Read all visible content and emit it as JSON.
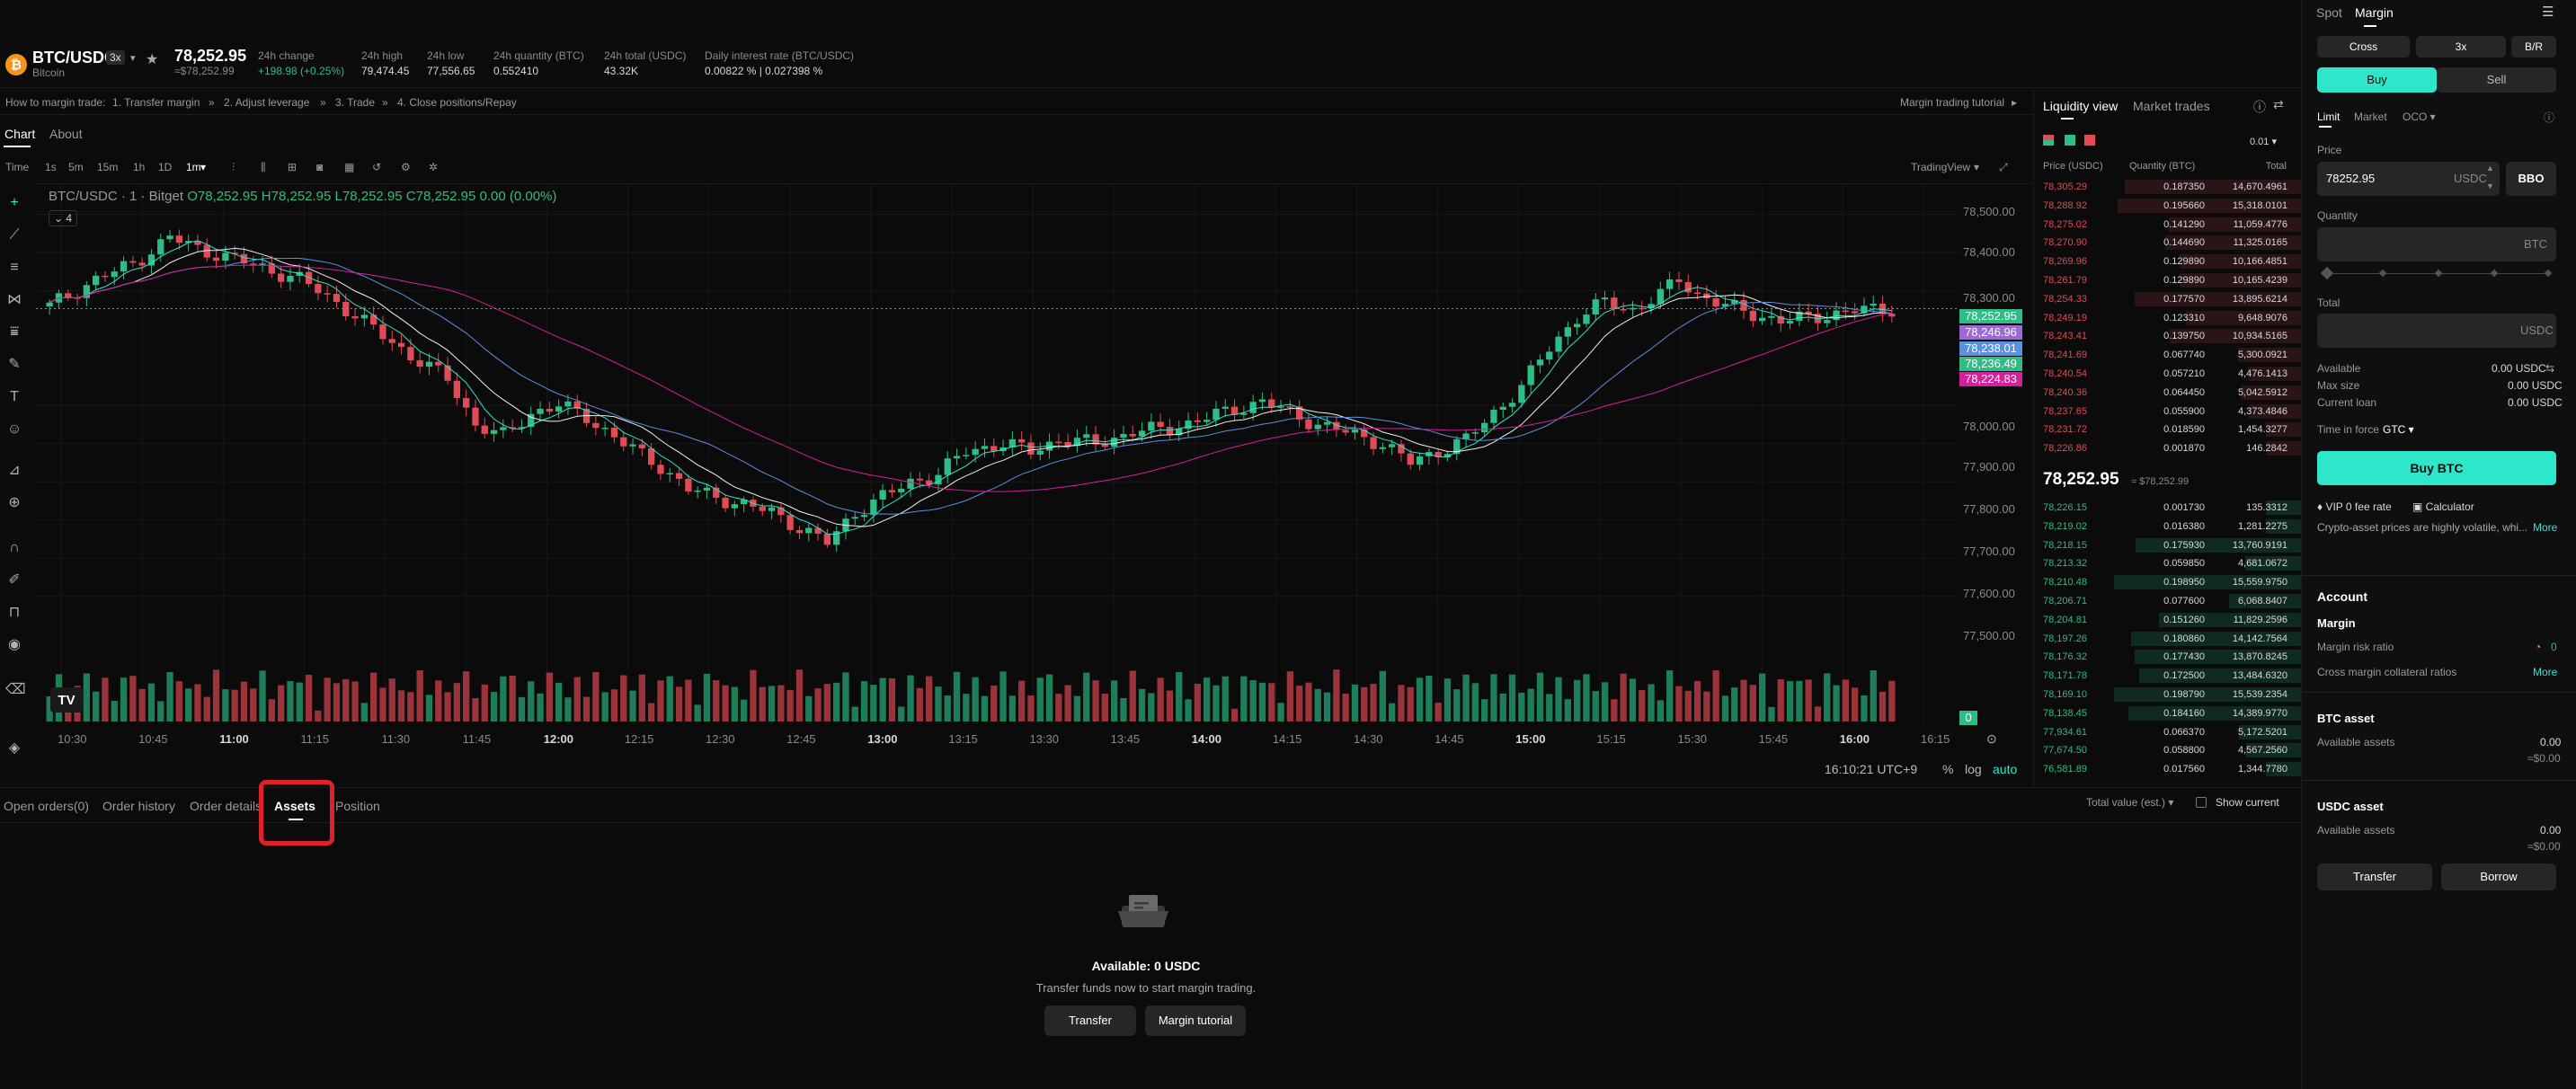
{
  "ticker": {
    "pair": "BTC/USDC",
    "leverage": "3x",
    "coin_name": "Bitcoin",
    "coin_glyph": "₿",
    "last_price": "78,252.95",
    "last_price_usd": "≈$78,252.99",
    "stats": [
      {
        "label": "24h change",
        "value": "+198.98 (+0.25%)"
      },
      {
        "label": "24h high",
        "value": "79,474.45"
      },
      {
        "label": "24h low",
        "value": "77,556.65"
      },
      {
        "label": "24h quantity (BTC)",
        "value": "0.552410"
      },
      {
        "label": "24h total (USDC)",
        "value": "43.32K"
      },
      {
        "label": "Daily interest rate (BTC/USDC)",
        "value": "0.00822 % | 0.027398 %"
      }
    ]
  },
  "tutorial": {
    "lead": "How to margin trade:",
    "steps": [
      "1. Transfer margin",
      "2. Adjust leverage",
      "3. Trade",
      "4. Close positions/Repay"
    ],
    "sep": "»",
    "link": "Margin trading tutorial"
  },
  "chart_tabs": [
    "Chart",
    "About"
  ],
  "chart_toolbar": {
    "intervals": [
      "Time",
      "1s",
      "5m",
      "15m",
      "1h",
      "1D",
      "1m"
    ],
    "provider": "TradingView"
  },
  "chart_legend": {
    "title": "BTC/USDC · 1 · Bitget",
    "o": "O78,252.95",
    "h": "H78,252.95",
    "l": "L78,252.95",
    "c": "C78,252.95",
    "chg": "0.00 (0.00%)",
    "indicator_count": "4",
    "logo": "TV"
  },
  "chart_data": {
    "type": "candlestick",
    "interval": "1m",
    "y_ticks": [
      "78,500.00",
      "78,400.00",
      "78,300.00",
      "78,000.00",
      "77,900.00",
      "77,800.00",
      "77,700.00",
      "77,600.00",
      "77,500.00"
    ],
    "ylim": [
      77450,
      78560
    ],
    "x_ticks": [
      "10:30",
      "10:45",
      "11:00",
      "11:15",
      "11:30",
      "11:45",
      "12:00",
      "12:15",
      "12:30",
      "12:45",
      "13:00",
      "13:15",
      "13:30",
      "13:45",
      "14:00",
      "14:15",
      "14:30",
      "14:45",
      "15:00",
      "15:15",
      "15:30",
      "15:45",
      "16:00",
      "16:15"
    ],
    "bold_x_ticks": [
      "11:00",
      "12:00",
      "13:00",
      "14:00",
      "15:00",
      "16:00"
    ],
    "close_path": [
      [
        0,
        78260
      ],
      [
        5,
        78330
      ],
      [
        9,
        78370
      ],
      [
        13,
        78440
      ],
      [
        16,
        78410
      ],
      [
        19,
        78390
      ],
      [
        23,
        78360
      ],
      [
        27,
        78330
      ],
      [
        31,
        78270
      ],
      [
        35,
        78200
      ],
      [
        39,
        78130
      ],
      [
        43,
        78070
      ],
      [
        46,
        77950
      ],
      [
        49,
        77920
      ],
      [
        52,
        77980
      ],
      [
        55,
        78000
      ],
      [
        58,
        77970
      ],
      [
        62,
        77900
      ],
      [
        66,
        77840
      ],
      [
        69,
        77780
      ],
      [
        72,
        77760
      ],
      [
        75,
        77740
      ],
      [
        78,
        77720
      ],
      [
        81,
        77680
      ],
      [
        84,
        77640
      ],
      [
        87,
        77720
      ],
      [
        90,
        77760
      ],
      [
        93,
        77800
      ],
      [
        96,
        77820
      ],
      [
        99,
        77880
      ],
      [
        103,
        77900
      ],
      [
        106,
        77880
      ],
      [
        109,
        77910
      ],
      [
        113,
        77900
      ],
      [
        117,
        77930
      ],
      [
        121,
        77940
      ],
      [
        124,
        77960
      ],
      [
        128,
        77990
      ],
      [
        131,
        78010
      ],
      [
        134,
        77980
      ],
      [
        137,
        77950
      ],
      [
        140,
        77930
      ],
      [
        144,
        77900
      ],
      [
        147,
        77850
      ],
      [
        150,
        77880
      ],
      [
        153,
        77910
      ],
      [
        156,
        77980
      ],
      [
        159,
        78050
      ],
      [
        162,
        78150
      ],
      [
        165,
        78230
      ],
      [
        168,
        78270
      ],
      [
        171,
        78250
      ],
      [
        174,
        78290
      ],
      [
        176,
        78330
      ],
      [
        178,
        78290
      ],
      [
        181,
        78260
      ],
      [
        184,
        78240
      ],
      [
        187,
        78220
      ],
      [
        190,
        78230
      ],
      [
        193,
        78240
      ],
      [
        196,
        78250
      ],
      [
        199,
        78253
      ]
    ],
    "price_tags": [
      {
        "value": "78,252.95",
        "color": "#2ebd85"
      },
      {
        "value": "78,246.96",
        "color": "#9b6ad4"
      },
      {
        "value": "78,238.01",
        "color": "#5b8fe0"
      },
      {
        "value": "78,236.49",
        "color": "#2ebd85"
      },
      {
        "value": "78,224.83",
        "color": "#d4209a"
      }
    ],
    "volume_tag": "0"
  },
  "timestamp": "16:10:21 UTC+9",
  "scale_opts": [
    "%",
    "log",
    "auto"
  ],
  "orderbook": {
    "tabs": [
      "Liquidity view",
      "Market trades"
    ],
    "tick": "0.01",
    "headers": [
      "Price (USDC)",
      "Quantity (BTC)",
      "Total"
    ],
    "asks": [
      [
        "78,305.29",
        "0.187350",
        "14,670.4961"
      ],
      [
        "78,288.92",
        "0.195660",
        "15,318.0101"
      ],
      [
        "78,275.02",
        "0.141290",
        "11,059.4776"
      ],
      [
        "78,270.90",
        "0.144690",
        "11,325.0165"
      ],
      [
        "78,269.96",
        "0.129890",
        "10,166.4851"
      ],
      [
        "78,261.79",
        "0.129890",
        "10,165.4239"
      ],
      [
        "78,254.33",
        "0.177570",
        "13,895.6214"
      ],
      [
        "78,249.19",
        "0.123310",
        "9,648.9076"
      ],
      [
        "78,243.41",
        "0.139750",
        "10,934.5165"
      ],
      [
        "78,241.69",
        "0.067740",
        "5,300.0921"
      ],
      [
        "78,240.54",
        "0.057210",
        "4,476.1413"
      ],
      [
        "78,240.36",
        "0.064450",
        "5,042.5912"
      ],
      [
        "78,237.65",
        "0.055900",
        "4,373.4846"
      ],
      [
        "78,231.72",
        "0.018590",
        "1,454.3277"
      ],
      [
        "78,226.86",
        "0.001870",
        "146.2842"
      ]
    ],
    "mid_price": "78,252.95",
    "mid_usd": "≈ $78,252.99",
    "bids": [
      [
        "78,226.15",
        "0.001730",
        "135.3312"
      ],
      [
        "78,219.02",
        "0.016380",
        "1,281.2275"
      ],
      [
        "78,218.15",
        "0.175930",
        "13,760.9191"
      ],
      [
        "78,213.32",
        "0.059850",
        "4,681.0672"
      ],
      [
        "78,210.48",
        "0.198950",
        "15,559.9750"
      ],
      [
        "78,206.71",
        "0.077600",
        "6,068.8407"
      ],
      [
        "78,204.81",
        "0.151260",
        "11,829.2596"
      ],
      [
        "78,197.26",
        "0.180860",
        "14,142.7564"
      ],
      [
        "78,176.32",
        "0.177430",
        "13,870.8245"
      ],
      [
        "78,171.78",
        "0.172500",
        "13,484.6320"
      ],
      [
        "78,169.10",
        "0.198790",
        "15,539.2354"
      ],
      [
        "78,138.45",
        "0.184160",
        "14,389.9770"
      ],
      [
        "77,934.61",
        "0.066370",
        "5,172.5201"
      ],
      [
        "77,674.50",
        "0.058800",
        "4,567.2560"
      ],
      [
        "76,581.89",
        "0.017560",
        "1,344.7780"
      ]
    ]
  },
  "bottom_tabs": {
    "items": [
      "Open orders(0)",
      "Order history",
      "Order details",
      "Assets",
      "Position"
    ],
    "active": "Assets",
    "total_value": "Total value (est.)",
    "show_current": "Show current"
  },
  "empty_state": {
    "available": "Available: 0 USDC",
    "message": "Transfer funds now to start margin trading.",
    "transfer_btn": "Transfer",
    "tutorial_btn": "Margin tutorial"
  },
  "order_panel": {
    "tabs": [
      "Spot",
      "Margin"
    ],
    "mode": [
      "Cross",
      "3x",
      "B/R"
    ],
    "side": [
      "Buy",
      "Sell"
    ],
    "order_types": [
      "Limit",
      "Market",
      "OCO"
    ],
    "price_label": "Price",
    "price_value": "78252.95",
    "price_unit": "USDC",
    "bbo": "BBO",
    "quantity_label": "Quantity",
    "quantity_unit": "BTC",
    "total_label": "Total",
    "total_unit": "USDC",
    "available_label": "Available",
    "available_value": "0.00 USDC",
    "maxsize_label": "Max size",
    "maxsize_value": "0.00 USDC",
    "loan_label": "Current loan",
    "loan_value": "0.00 USDC",
    "tif_label": "Time in force",
    "tif_value": "GTC",
    "buy_btn": "Buy BTC",
    "vip": "VIP 0 fee rate",
    "calculator": "Calculator",
    "warning": "Crypto-asset prices are highly volatile, whi...",
    "more": "More"
  },
  "account": {
    "title": "Account",
    "margin_title": "Margin",
    "risk_label": "Margin risk ratio",
    "risk_value": "0",
    "collateral_label": "Cross margin collateral ratios",
    "collateral_more": "More",
    "btc_title": "BTC asset",
    "btc_avail_label": "Available assets",
    "btc_avail_value": "0.00",
    "btc_avail_usd": "≈$0.00",
    "usdc_title": "USDC asset",
    "usdc_avail_label": "Available assets",
    "usdc_avail_value": "0.00",
    "usdc_avail_usd": "≈$0.00",
    "transfer_btn": "Transfer",
    "borrow_btn": "Borrow"
  },
  "colors": {
    "up": "#2ebd85",
    "down": "#e04b55",
    "accent": "#2ee6c9",
    "highlight": "#e0202a"
  }
}
